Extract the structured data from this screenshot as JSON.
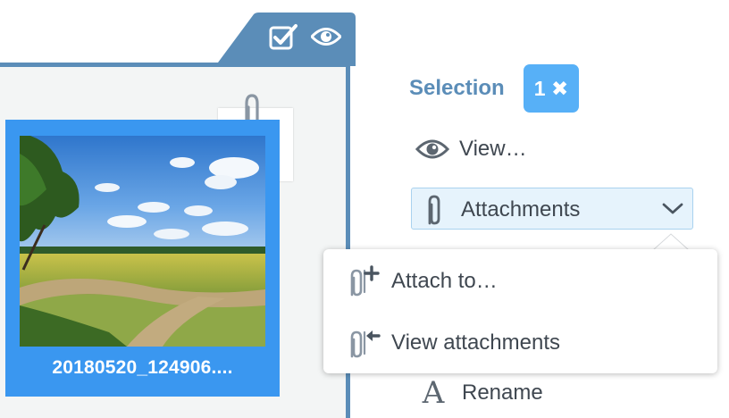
{
  "file_card": {
    "name": "20180520_124906...."
  },
  "selection": {
    "title": "Selection",
    "badge": "1 ✖"
  },
  "actions": {
    "view": "View…",
    "attachments": "Attachments",
    "rename": "Rename",
    "rename_glyph": "A"
  },
  "dropdown": {
    "items": [
      "Attach to…",
      "View attachments"
    ]
  },
  "colors": {
    "frame": "#5b8db8",
    "card": "#3a97f0",
    "badge": "#57b0f7",
    "button_bg": "#e6f3fc",
    "text": "#3f4750"
  },
  "icons": {
    "tab": [
      "checkbox-checked-icon",
      "eye-icon"
    ],
    "view": "eye-icon",
    "attachments": "paperclip-icon",
    "chevron": "chevron-down-icon",
    "attach_to": "paperclip-plus-icon",
    "view_attachments": "paperclip-arrow-icon"
  }
}
